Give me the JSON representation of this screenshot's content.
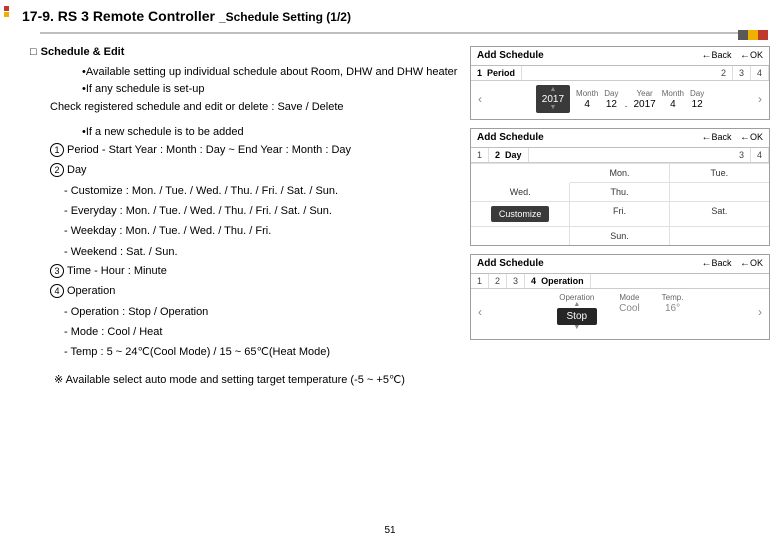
{
  "header": {
    "title": "17-9. RS 3 Remote Controller",
    "subtitle": "_Schedule Setting (1/2)"
  },
  "left": {
    "section": "Schedule & Edit",
    "b1": "Available setting up individual schedule about Room, DHW and DHW heater",
    "b2": "If any schedule is set-up",
    "b2a": "Check registered schedule and edit or delete : Save / Delete",
    "b3": "If a new schedule is to be added",
    "i1": "Period - Start Year : Month : Day ~ End Year : Month : Day",
    "i2": "Day",
    "i2a": "- Customize : Mon. / Tue. / Wed. / Thu. / Fri. / Sat. / Sun.",
    "i2b": "- Everyday : Mon. / Tue. / Wed. / Thu. / Fri. / Sat. / Sun.",
    "i2c": "- Weekday : Mon. / Tue. / Wed. / Thu. / Fri.",
    "i2d": "- Weekend : Sat. / Sun.",
    "i3": "Time - Hour : Minute",
    "i4": "Operation",
    "i4a": "-  Operation : Stop / Operation",
    "i4b": "-  Mode : Cool / Heat",
    "i4c": "-  Temp : 5 ~ 24℃(Cool Mode) / 15 ~ 65℃(Heat Mode)",
    "note": "※ Available select auto mode and setting target temperature (-5 ~ +5℃)"
  },
  "panels": {
    "p1": {
      "title": "Add Schedule",
      "back": "Back",
      "ok": "OK",
      "stepNum": "1",
      "stepLabel": "Period",
      "s2": "2",
      "s3": "3",
      "s4": "4",
      "labMonth": "Month",
      "labDay": "Day",
      "labYear": "Year",
      "year": "2017",
      "month": "4",
      "day": "12",
      "year2": "2017",
      "month2": "4",
      "day2": "12"
    },
    "p2": {
      "title": "Add Schedule",
      "back": "Back",
      "ok": "OK",
      "s1": "1",
      "stepNum": "2",
      "stepLabel": "Day",
      "s3": "3",
      "s4": "4",
      "d0": "Mon.",
      "d1": "Tue.",
      "d2": "Wed.",
      "d3": "Thu.",
      "sel": "Customize",
      "d5": "Fri.",
      "d6": "Sat.",
      "d7": "Sun."
    },
    "p3": {
      "title": "Add Schedule",
      "back": "Back",
      "ok": "OK",
      "s1": "1",
      "s2": "2",
      "s3": "3",
      "stepNum": "4",
      "stepLabel": "Operation",
      "labOp": "Operation",
      "labMode": "Mode",
      "labTemp": "Temp.",
      "valOp": "Stop",
      "valMode": "Cool",
      "valTemp": "16°"
    }
  },
  "page": "51"
}
